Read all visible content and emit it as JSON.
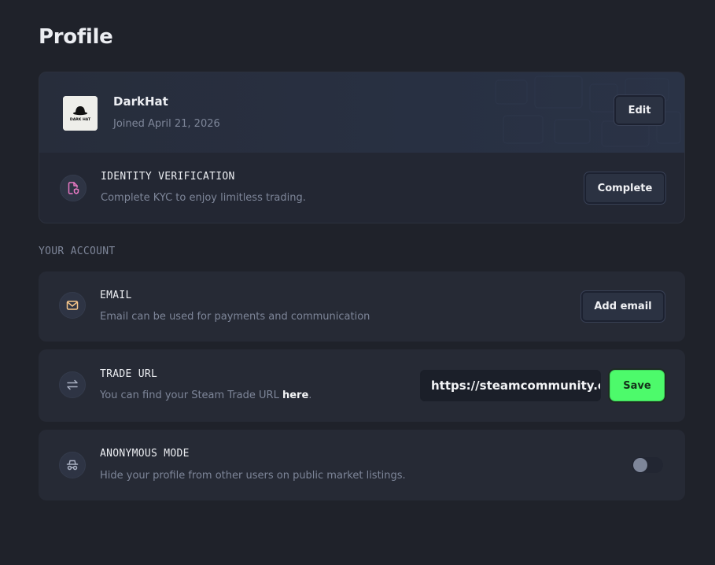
{
  "page": {
    "title": "Profile"
  },
  "profile": {
    "name": "DarkHat",
    "joined": "Joined April 21, 2026",
    "edit_label": "Edit",
    "avatar_text": "DARK HAT"
  },
  "kyc": {
    "title": "IDENTITY VERIFICATION",
    "description": "Complete KYC to enjoy limitless trading.",
    "button_label": "Complete",
    "icon": "file-shield-icon",
    "icon_color": "#e879c4"
  },
  "account": {
    "section_label": "YOUR ACCOUNT",
    "email": {
      "title": "EMAIL",
      "description": "Email can be used for payments and communication",
      "button_label": "Add email",
      "icon": "mail-icon",
      "icon_color": "#f4c58a"
    },
    "trade_url": {
      "title": "TRADE URL",
      "description_prefix": "You can find your Steam Trade URL ",
      "link_text": "here",
      "description_suffix": ".",
      "input_value": "https://steamcommunity.com/tradeoffer/new/",
      "save_label": "Save",
      "icon": "arrows-swap-icon"
    },
    "anonymous": {
      "title": "ANONYMOUS MODE",
      "description": "Hide your profile from other users on public market listings.",
      "enabled": false,
      "icon": "incognito-icon"
    }
  },
  "colors": {
    "background": "#1f222a",
    "card": "#262a35",
    "accent_green": "#4dfa6b",
    "muted_text": "#7e8699"
  }
}
